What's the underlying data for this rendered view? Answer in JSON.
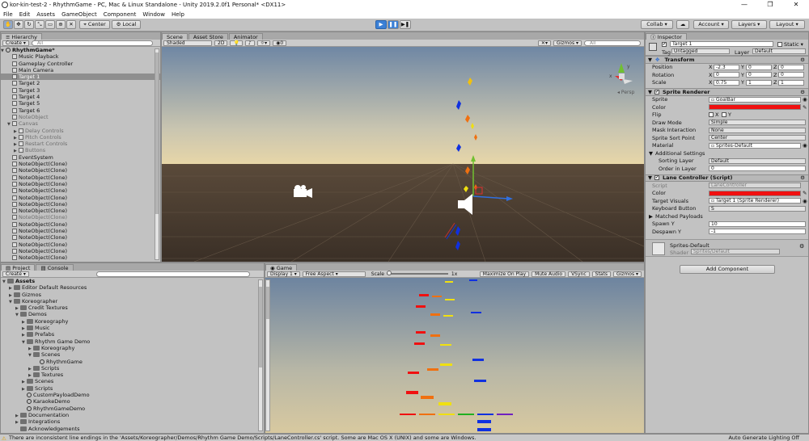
{
  "window": {
    "title": "kor-kin-test-2 - RhythmGame - PC, Mac & Linux Standalone - Unity 2019.2.0f1 Personal* <DX11>",
    "minimize": "—",
    "maximize": "❐",
    "close": "✕"
  },
  "menu": [
    "File",
    "Edit",
    "Assets",
    "GameObject",
    "Component",
    "Window",
    "Help"
  ],
  "toolbar": {
    "pivot": "Center",
    "space": "Local",
    "collab": "Collab ▾",
    "account": "Account ▾",
    "layers": "Layers ▾",
    "layout": "Layout ▾"
  },
  "hierarchy": {
    "tab": "Hierarchy",
    "create": "Create ▾",
    "search_placeholder": "All",
    "scene": "RhythmGame*",
    "items": [
      {
        "label": "Music Playback",
        "indent": 1,
        "style": "normal"
      },
      {
        "label": "Gameplay Controller",
        "indent": 1,
        "style": "normal"
      },
      {
        "label": "Main Camera",
        "indent": 1,
        "style": "normal"
      },
      {
        "label": "Target 1",
        "indent": 1,
        "style": "selected"
      },
      {
        "label": "Target 2",
        "indent": 1,
        "style": "normal"
      },
      {
        "label": "Target 3",
        "indent": 1,
        "style": "normal"
      },
      {
        "label": "Target 4",
        "indent": 1,
        "style": "normal"
      },
      {
        "label": "Target 5",
        "indent": 1,
        "style": "normal"
      },
      {
        "label": "Target 6",
        "indent": 1,
        "style": "normal"
      },
      {
        "label": "NoteObject",
        "indent": 1,
        "style": "gray"
      },
      {
        "label": "Canvas",
        "indent": 1,
        "style": "gray",
        "arrow": "▼"
      },
      {
        "label": "Delay Controls",
        "indent": 2,
        "style": "gray",
        "arrow": "▶"
      },
      {
        "label": "Pitch Controls",
        "indent": 2,
        "style": "gray",
        "arrow": "▶"
      },
      {
        "label": "Restart Controls",
        "indent": 2,
        "style": "gray",
        "arrow": "▶"
      },
      {
        "label": "Buttons",
        "indent": 2,
        "style": "gray",
        "arrow": "▶"
      },
      {
        "label": "EventSystem",
        "indent": 1,
        "style": "normal"
      },
      {
        "label": "NoteObject(Clone)",
        "indent": 1,
        "style": "normal"
      },
      {
        "label": "NoteObject(Clone)",
        "indent": 1,
        "style": "normal"
      },
      {
        "label": "NoteObject(Clone)",
        "indent": 1,
        "style": "normal"
      },
      {
        "label": "NoteObject(Clone)",
        "indent": 1,
        "style": "normal"
      },
      {
        "label": "NoteObject(Clone)",
        "indent": 1,
        "style": "normal"
      },
      {
        "label": "NoteObject(Clone)",
        "indent": 1,
        "style": "normal"
      },
      {
        "label": "NoteObject(Clone)",
        "indent": 1,
        "style": "normal"
      },
      {
        "label": "NoteObject(Clone)",
        "indent": 1,
        "style": "normal"
      },
      {
        "label": "NoteObject(Clone)",
        "indent": 1,
        "style": "gray"
      },
      {
        "label": "NoteObject(Clone)",
        "indent": 1,
        "style": "normal"
      },
      {
        "label": "NoteObject(Clone)",
        "indent": 1,
        "style": "normal"
      },
      {
        "label": "NoteObject(Clone)",
        "indent": 1,
        "style": "normal"
      },
      {
        "label": "NoteObject(Clone)",
        "indent": 1,
        "style": "normal"
      },
      {
        "label": "NoteObject(Clone)",
        "indent": 1,
        "style": "normal"
      },
      {
        "label": "NoteObject(Clone)",
        "indent": 1,
        "style": "normal"
      },
      {
        "label": "NoteObject(Clone)",
        "indent": 1,
        "style": "normal"
      }
    ]
  },
  "scene": {
    "tabs": [
      "Scene",
      "Asset Store",
      "Animator"
    ],
    "shading": "Shaded",
    "mode2d": "2D",
    "gizmos": "Gizmos ▾",
    "search_placeholder": "All",
    "persp": "◂ Persp",
    "axis_x": "x",
    "axis_y": "y"
  },
  "project": {
    "tabs": [
      "Project",
      "Console"
    ],
    "create": "Create ▾",
    "items": [
      {
        "label": "Assets",
        "indent": 0,
        "arrow": "▼",
        "bold": true
      },
      {
        "label": "Editor Default Resources",
        "indent": 1,
        "arrow": "▶"
      },
      {
        "label": "Gizmos",
        "indent": 1,
        "arrow": "▶"
      },
      {
        "label": "Koreographer",
        "indent": 1,
        "arrow": "▼"
      },
      {
        "label": "Credit Textures",
        "indent": 2,
        "arrow": "▶"
      },
      {
        "label": "Demos",
        "indent": 2,
        "arrow": "▼"
      },
      {
        "label": "Koreography",
        "indent": 3,
        "arrow": "▶"
      },
      {
        "label": "Music",
        "indent": 3,
        "arrow": "▶"
      },
      {
        "label": "Prefabs",
        "indent": 3,
        "arrow": "▶"
      },
      {
        "label": "Rhythm Game Demo",
        "indent": 3,
        "arrow": "▼"
      },
      {
        "label": "Koreography",
        "indent": 4,
        "arrow": "▶"
      },
      {
        "label": "Scenes",
        "indent": 4,
        "arrow": "▼"
      },
      {
        "label": "RhythmGame",
        "indent": 5,
        "arrow": "",
        "unity": true
      },
      {
        "label": "Scripts",
        "indent": 4,
        "arrow": "▶"
      },
      {
        "label": "Textures",
        "indent": 4,
        "arrow": "▶"
      },
      {
        "label": "Scenes",
        "indent": 3,
        "arrow": "▶"
      },
      {
        "label": "Scripts",
        "indent": 3,
        "arrow": "▶"
      },
      {
        "label": "CustomPayloadDemo",
        "indent": 3,
        "arrow": "",
        "unity": true
      },
      {
        "label": "KaraokeDemo",
        "indent": 3,
        "arrow": "",
        "unity": true
      },
      {
        "label": "RhythmGameDemo",
        "indent": 3,
        "arrow": "",
        "unity": true
      },
      {
        "label": "Documentation",
        "indent": 2,
        "arrow": "▶"
      },
      {
        "label": "Integrations",
        "indent": 2,
        "arrow": "▶"
      },
      {
        "label": "Acknowledgements",
        "indent": 2,
        "arrow": ""
      }
    ]
  },
  "game": {
    "tab": "Game",
    "display": "Display 1 ▾",
    "aspect": "Free Aspect ▾",
    "scale_label": "Scale",
    "scale_value": "1x",
    "maximize": "Maximize On Play",
    "mute": "Mute Audio",
    "vsync": "VSync",
    "stats": "Stats",
    "gizmos": "Gizmos ▾"
  },
  "inspector": {
    "tab": "Inspector",
    "object_name": "Target 1",
    "static": "Static ▾",
    "tag_label": "Tag",
    "tag": "Untagged",
    "layer_label": "Layer",
    "layer": "Default",
    "transform": {
      "title": "Transform",
      "rows": [
        {
          "label": "Position",
          "x": "-2.3",
          "y": "0",
          "z": "0"
        },
        {
          "label": "Rotation",
          "x": "0",
          "y": "0",
          "z": "0"
        },
        {
          "label": "Scale",
          "x": "0.75",
          "y": "1",
          "z": "1"
        }
      ]
    },
    "sprite_renderer": {
      "title": "Sprite Renderer",
      "sprite_label": "Sprite",
      "sprite": "GoalBar",
      "color_label": "Color",
      "flip_label": "Flip",
      "flip_x": "X",
      "flip_y": "Y",
      "draw_mode_label": "Draw Mode",
      "draw_mode": "Simple",
      "mask_label": "Mask Interaction",
      "mask": "None",
      "sort_point_label": "Sprite Sort Point",
      "sort_point": "Center",
      "material_label": "Material",
      "material": "Sprites-Default",
      "additional": "Additional Settings",
      "sorting_layer_label": "Sorting Layer",
      "sorting_layer": "Default",
      "order_label": "Order in Layer",
      "order": "0"
    },
    "lane_controller": {
      "title": "Lane Controller (Script)",
      "script_label": "Script",
      "script": "LaneController",
      "color_label": "Color",
      "target_visuals_label": "Target Visuals",
      "target_visuals": "Target 1 (Sprite Renderer)",
      "keyboard_label": "Keyboard Button",
      "keyboard": "S",
      "payloads_label": "Matched Payloads",
      "spawn_label": "Spawn Y",
      "spawn": "10",
      "despawn_label": "Despawn Y",
      "despawn": "-1"
    },
    "material_block": {
      "name": "Sprites-Default",
      "shader_label": "Shader",
      "shader": "Sprites/Default"
    },
    "add_component": "Add Component"
  },
  "status": {
    "message": "There are inconsistent line endings in the 'Assets/Koreographer/Demos/Rhythm Game Demo/Scripts/LaneController.cs' script. Some are Mac OS X (UNIX) and some are Windows.",
    "right": "Auto Generate Lighting Off"
  },
  "colors": {
    "red": "#f01010",
    "orange": "#f07010",
    "yellow": "#f0e010",
    "green": "#20b020",
    "blue": "#1030e0",
    "purple": "#7020c0"
  }
}
